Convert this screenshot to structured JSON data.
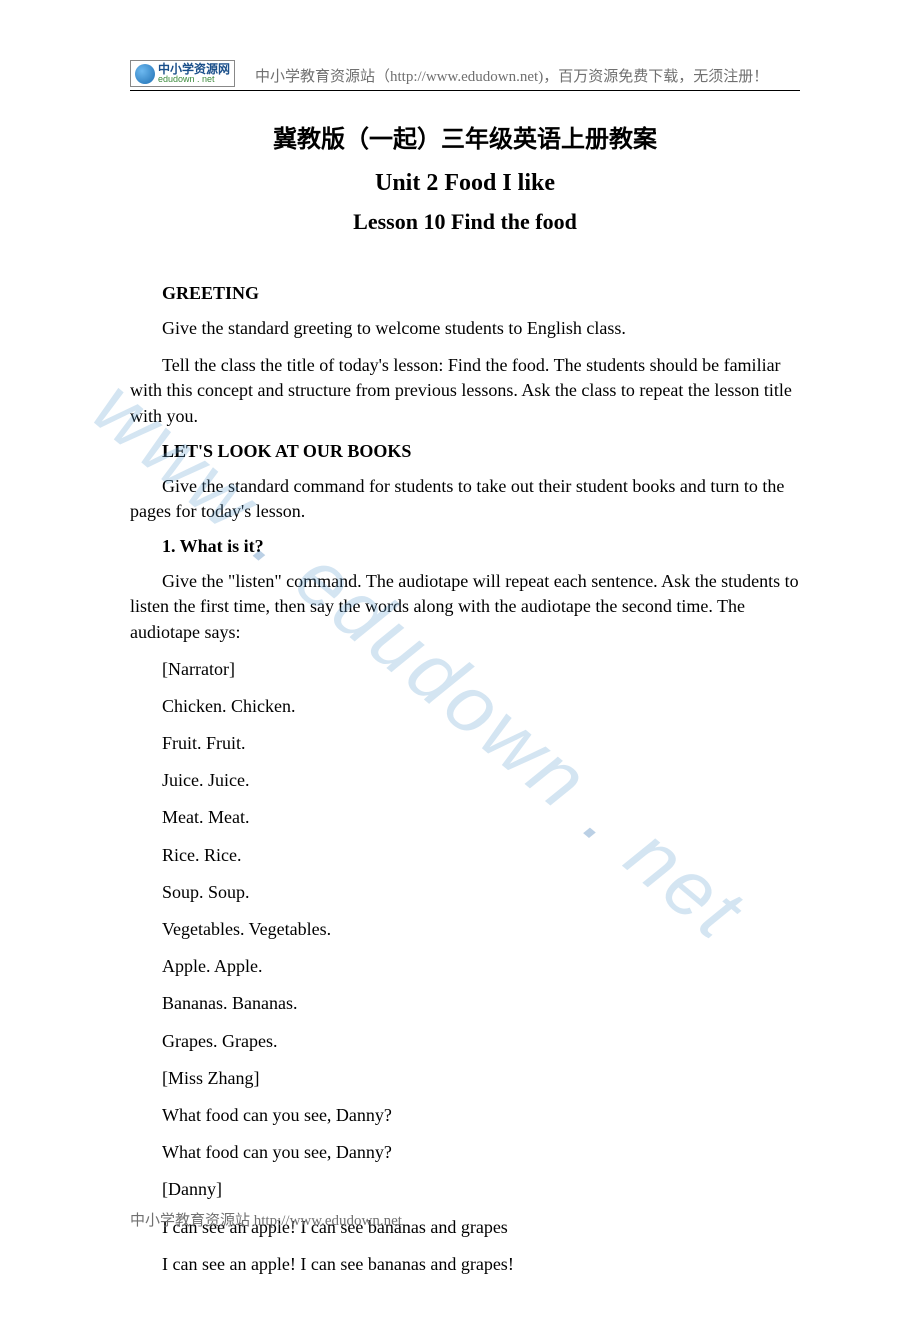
{
  "header": {
    "logo_cn": "中小学资源网",
    "logo_en": "edudown . net",
    "text": "中小学教育资源站（http://www.edudown.net)，百万资源免费下载，无须注册！"
  },
  "watermark": {
    "part1": "www",
    "dot1": " . ",
    "part2": "edudown",
    "dot2": " . ",
    "part3": "net"
  },
  "titles": {
    "cn": "冀教版（一起）三年级英语上册教案",
    "en1": "Unit 2 Food I like",
    "en2": "Lesson 10 Find the food"
  },
  "sections": {
    "greeting_head": "GREETING",
    "greeting_p1": "Give the standard greeting to welcome students to English class.",
    "greeting_p2": "Tell the class the title of today's lesson: Find the food. The students should be familiar with this concept and structure from previous lessons. Ask the class to repeat the lesson title with you.",
    "books_head": "LET'S LOOK AT OUR BOOKS",
    "books_p1": "Give the standard command for students to take out their student books and turn to the pages for today's lesson.",
    "q1_head": "1. What is it?",
    "q1_p1": "Give the \"listen\" command. The audiotape will repeat each sentence. Ask the students to listen the first time, then say the words along with the audiotape the second time. The audiotape says:"
  },
  "lines": [
    "[Narrator]",
    "Chicken. Chicken.",
    "Fruit. Fruit.",
    "Juice. Juice.",
    "Meat. Meat.",
    "Rice. Rice.",
    "Soup. Soup.",
    "Vegetables. Vegetables.",
    "Apple. Apple.",
    "Bananas. Bananas.",
    "Grapes. Grapes.",
    "[Miss Zhang]",
    "What food can you see, Danny?",
    "What food can you see, Danny?",
    "[Danny]",
    "I can see an apple! I can see bananas and grapes",
    "I can see an apple! I can see bananas and grapes!"
  ],
  "footer": "中小学教育资源站  http://www.edudown.net"
}
